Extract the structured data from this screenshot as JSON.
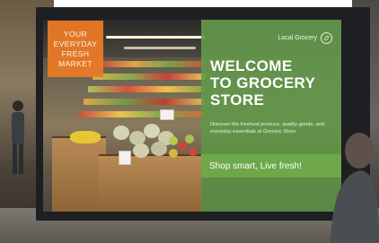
{
  "poster": {
    "badge_lines": [
      "YOUR",
      "EVERYDAY",
      "FRESH",
      "MARKET"
    ],
    "brand": "Local Grocery",
    "headline_lines": [
      "WELCOME",
      "TO GROCERY",
      "STORE"
    ],
    "tagline": "Discover the freshest produce, quality goods, and everyday essentials at Grocery Store.",
    "slogan": "Shop smart, Live fresh!"
  },
  "colors": {
    "badge_orange": "#e97a26",
    "panel_green": "#669c4e",
    "slogan_green": "#6ea84a",
    "frame": "#1d1f22"
  }
}
